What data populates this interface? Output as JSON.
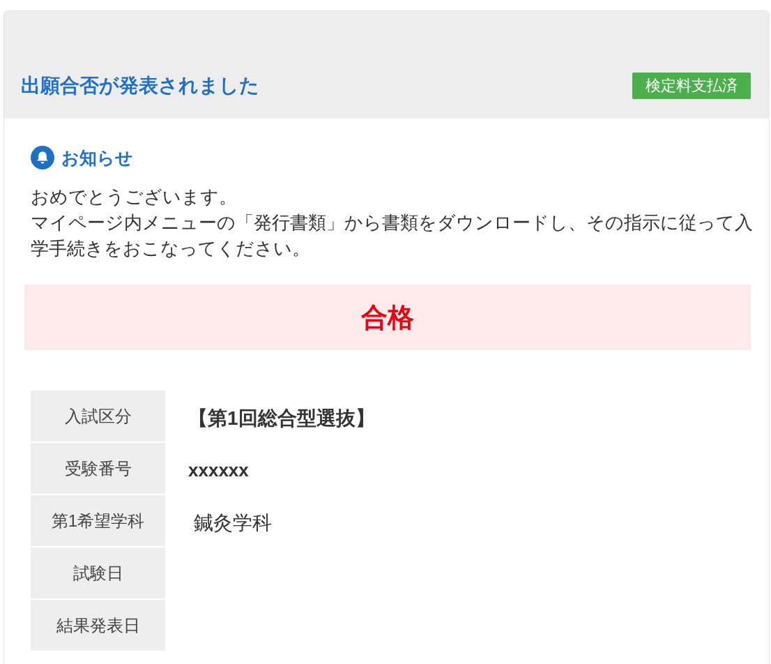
{
  "header": {
    "title": "出願合否が発表されました",
    "badge": "検定料支払済"
  },
  "notice": {
    "title": "お知らせ",
    "paragraphs": [
      "おめでとうございます。",
      "マイページ内メニューの「発行書類」から書類をダウンロードし、その指示に従って入学手続きをおこなってください。"
    ]
  },
  "result": {
    "label": "合格"
  },
  "details": [
    {
      "label": "入試区分",
      "value": "【第1回総合型選抜】",
      "emphasized": true
    },
    {
      "label": "受験番号",
      "value": "xxxxxx",
      "emphasized": true
    },
    {
      "label": "第1希望学科",
      "value": "鍼灸学科",
      "emphasized": false
    },
    {
      "label": "試験日"
    },
    {
      "label": "結果発表日"
    }
  ]
}
